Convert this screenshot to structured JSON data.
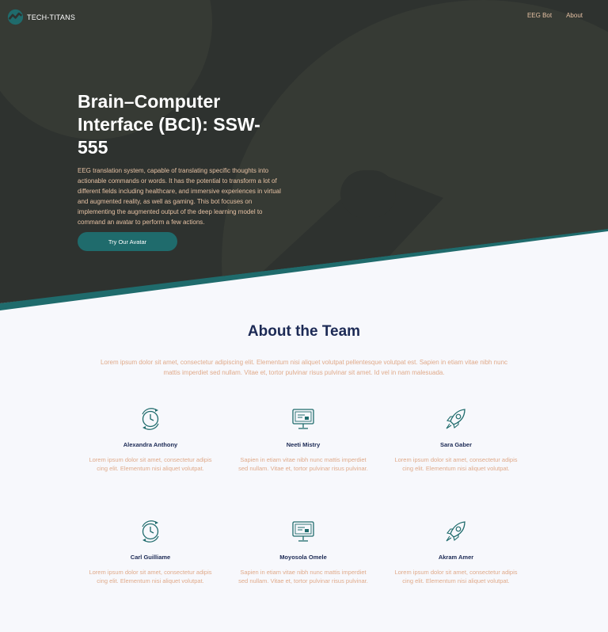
{
  "brand": {
    "name": "TECH-TITANS"
  },
  "nav": {
    "items": [
      "EEG Bot",
      "About"
    ]
  },
  "hero": {
    "title": "Brain–Computer Interface (BCI): SSW-555",
    "description": "EEG translation system, capable of translating specific thoughts into actionable commands or words. It has the potential to transform a lot of different fields including healthcare, and immersive experiences in virtual and augmented reality, as well as gaming. This bot focuses on implementing the augmented output of the deep learning model to command an avatar to perform a few actions.",
    "cta_label": "Try Our Avatar"
  },
  "about": {
    "title": "About the Team",
    "description": "Lorem ipsum dolor sit amet, consectetur adipiscing elit. Elementum nisi aliquet volutpat pellentesque volutpat est. Sapien in etiam vitae nibh nunc mattis imperdiet sed nullam. Vitae et, tortor pulvinar risus pulvinar sit amet. Id vel in nam malesuada."
  },
  "team": [
    {
      "name": "Alexandra Anthony",
      "icon": "clock-icon",
      "desc": "Lorem ipsum dolor sit amet, consectetur adipis cing elit. Elementum nisi aliquet volutpat."
    },
    {
      "name": "Neeti Mistry",
      "icon": "monitor-icon",
      "desc": "Sapien in etiam vitae nibh nunc mattis imperdiet sed nullam. Vitae et, tortor pulvinar risus pulvinar."
    },
    {
      "name": "Sara Gaber",
      "icon": "rocket-icon",
      "desc": "Lorem ipsum dolor sit amet, consectetur adipis cing elit. Elementum nisi aliquet volutpat."
    },
    {
      "name": "Carl Guilliame",
      "icon": "clock-icon",
      "desc": "Lorem ipsum dolor sit amet, consectetur adipis cing elit. Elementum nisi aliquet volutpat."
    },
    {
      "name": "Moyosola Omele",
      "icon": "monitor-icon",
      "desc": "Sapien in etiam vitae nibh nunc mattis imperdiet sed nullam. Vitae et, tortor pulvinar risus pulvinar."
    },
    {
      "name": "Akram Amer",
      "icon": "rocket-icon",
      "desc": "Lorem ipsum dolor sit amet, consectetur adipis cing elit. Elementum nisi aliquet volutpat."
    }
  ],
  "colors": {
    "hero_bg": "#2e322f",
    "teal": "#1f6b6c",
    "navy": "#1c2a55",
    "peach": "#e0aa8a",
    "page_bg": "#f7f8fc"
  }
}
